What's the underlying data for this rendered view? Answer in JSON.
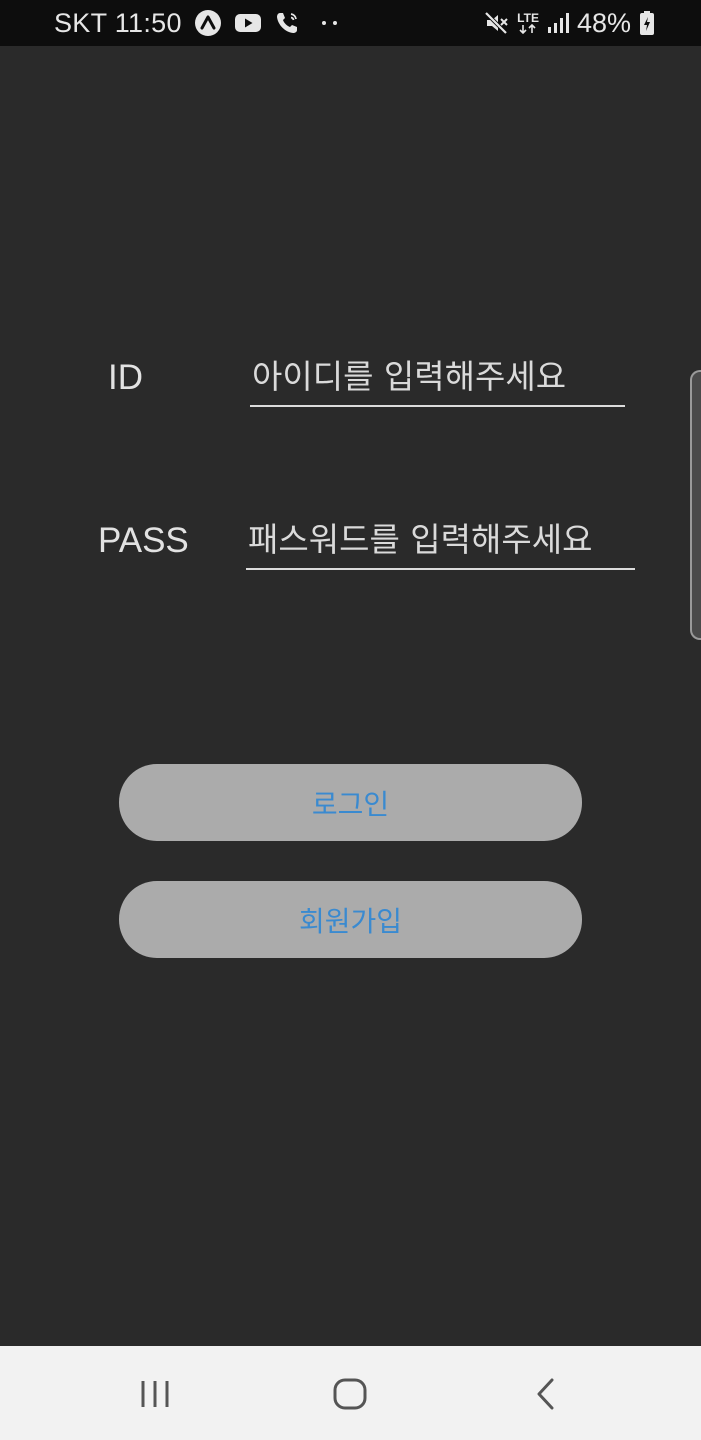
{
  "status_bar": {
    "carrier_time": "SKT 11:50",
    "icons_left": [
      "app-a-icon",
      "youtube-icon",
      "wifi-call-icon",
      "more-dots-icon"
    ],
    "icons_right": [
      "mute-icon",
      "lte-icon",
      "signal-icon"
    ],
    "lte_label": "LTE",
    "battery_percent": "48%",
    "battery_icon": "battery-charging-icon"
  },
  "login_form": {
    "id_label": "ID",
    "id_placeholder": "아이디를 입력해주세요",
    "pass_label": "PASS",
    "pass_placeholder": "패스워드를 입력해주세요"
  },
  "buttons": {
    "login_label": "로그인",
    "signup_label": "회원가입"
  },
  "nav_bar": {
    "items": [
      "recent-apps-icon",
      "home-icon",
      "back-icon"
    ]
  },
  "colors": {
    "background": "#2a2a2a",
    "status_bar": "#0d0d0d",
    "button_bg": "#ababab",
    "button_text": "#3a8ad0",
    "nav_bar": "#f2f2f2"
  }
}
